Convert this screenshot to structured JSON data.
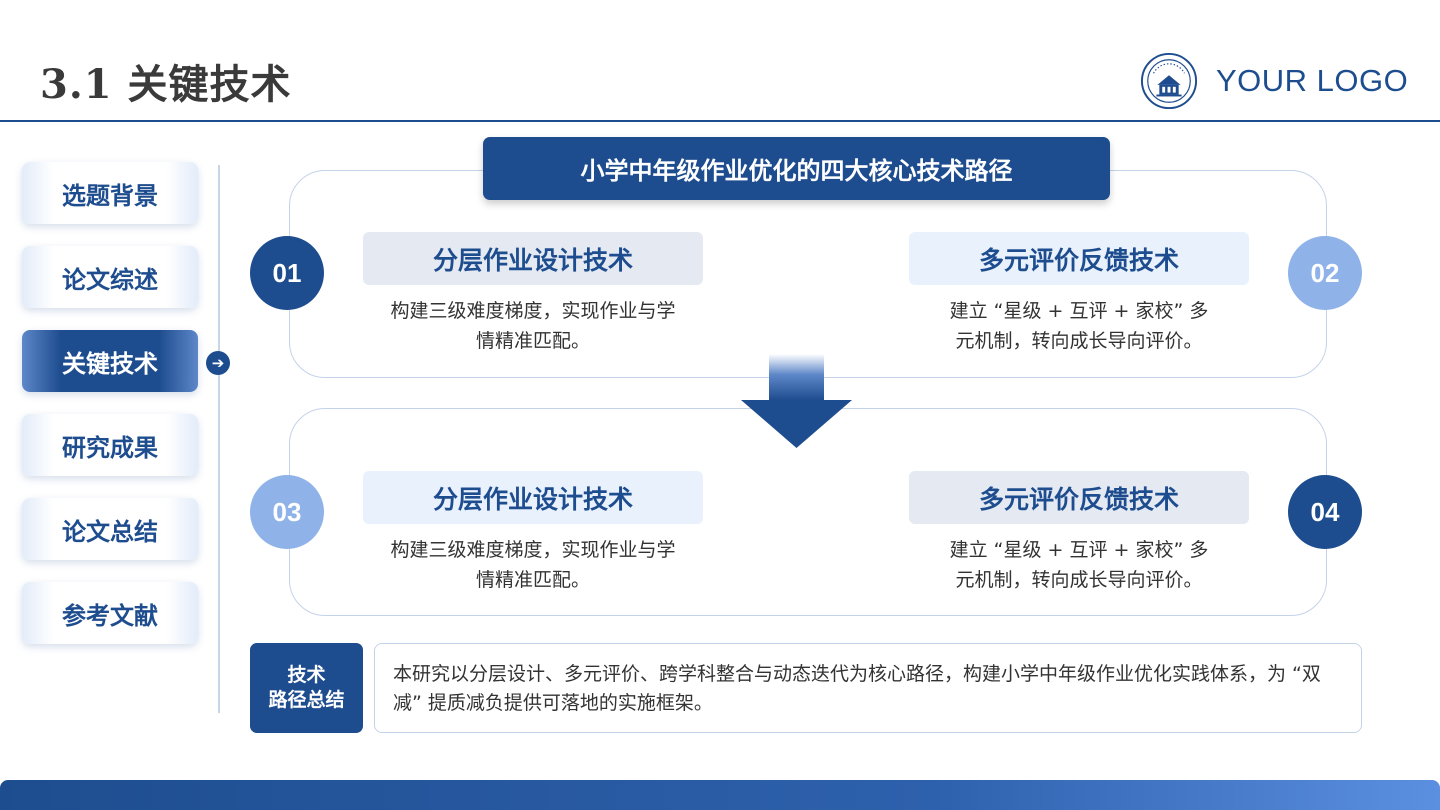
{
  "header": {
    "title": "3.1 关键技术",
    "logo_text": "YOUR LOGO"
  },
  "sidebar": {
    "items": [
      {
        "label": "选题背景",
        "active": false
      },
      {
        "label": "论文综述",
        "active": false
      },
      {
        "label": "关键技术",
        "active": true
      },
      {
        "label": "研究成果",
        "active": false
      },
      {
        "label": "论文总结",
        "active": false
      },
      {
        "label": "参考文献",
        "active": false
      }
    ],
    "marker_icon": "arrow-right-circle-icon"
  },
  "main": {
    "title": "小学中年级作业优化的四大核心技术路径",
    "cards": [
      {
        "number": "01",
        "title": "分层作业设计技术",
        "desc_line1": "构建三级难度梯度，实现作业与学",
        "desc_line2": "情精准匹配。"
      },
      {
        "number": "02",
        "title": "多元评价反馈技术",
        "desc_line1": "建立 “星级 + 互评 + 家校” 多",
        "desc_line2": "元机制，转向成长导向评价。"
      },
      {
        "number": "03",
        "title": "分层作业设计技术",
        "desc_line1": "构建三级难度梯度，实现作业与学",
        "desc_line2": "情精准匹配。"
      },
      {
        "number": "04",
        "title": "多元评价反馈技术",
        "desc_line1": "建立 “星级 + 互评 + 家校” 多",
        "desc_line2": "元机制，转向成长导向评价。"
      }
    ],
    "arrow_icon": "arrow-down-icon"
  },
  "summary": {
    "label_line1": "技术",
    "label_line2": "路径总结",
    "text": "本研究以分层设计、多元评价、跨学科整合与动态迭代为核心路径，构建小学中年级作业优化实践体系，为 “双减” 提质减负提供可落地的实施框架。"
  },
  "colors": {
    "primary": "#1e4d8f",
    "light_accent": "#8fb3e8",
    "border": "#c5d3e8"
  }
}
